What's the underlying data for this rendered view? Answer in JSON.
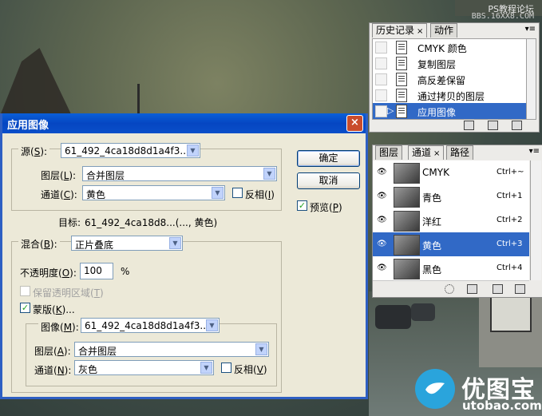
{
  "watermark": {
    "site_cn": "PS教程论坛",
    "site_url": "BBS.16XX8.COM",
    "brand_name": "优图宝",
    "brand_url": "utobao.com"
  },
  "history_panel": {
    "tabs": [
      {
        "label": "历史记录",
        "close": "×"
      },
      {
        "label": "动作"
      }
    ],
    "items": [
      "CMYK 颜色",
      "复制图层",
      "高反差保留",
      "通过拷贝的图层",
      "应用图像"
    ],
    "selected_index": 4,
    "menu_icon": "panel-menu-icon",
    "accent": "#3169c6"
  },
  "channels_panel": {
    "tabs": [
      {
        "label": "图层"
      },
      {
        "label": "通道",
        "close": "×"
      },
      {
        "label": "路径"
      }
    ],
    "channels": [
      {
        "name": "CMYK",
        "shortcut": "Ctrl+~"
      },
      {
        "name": "青色",
        "shortcut": "Ctrl+1"
      },
      {
        "name": "洋红",
        "shortcut": "Ctrl+2"
      },
      {
        "name": "黄色",
        "shortcut": "Ctrl+3"
      },
      {
        "name": "黑色",
        "shortcut": "Ctrl+4"
      }
    ],
    "selected_index": 3
  },
  "dialog": {
    "title": "应用图像",
    "source_label": "源(",
    "source_key": "S",
    "source_value": "61_492_4ca18d8d1a4f3...",
    "layer_label": "图层(",
    "layer_key": "L",
    "layer_value": "合并图层",
    "channel_label": "通道(",
    "channel_key": "C",
    "channel_value": "黄色",
    "invert_label": "反相(",
    "invert_key": "I",
    "invert_checked": false,
    "target_label": "目标:",
    "target_value": "61_492_4ca18d8...(..., 黄色)",
    "blend_label": "混合(",
    "blend_key": "B",
    "blend_value": "正片叠底",
    "opacity_label": "不透明度(",
    "opacity_key": "O",
    "opacity_value": "100",
    "opacity_unit": "%",
    "preserve_label": "保留透明区域(",
    "preserve_key": "T",
    "mask_label": "蒙版(",
    "mask_key": "K",
    "mask_suffix": ")...",
    "mask_checked": true,
    "mask_image_label": "图像(",
    "mask_image_key": "M",
    "mask_image_value": "61_492_4ca18d8d1a4f3...",
    "mask_layer_label": "图层(",
    "mask_layer_key": "A",
    "mask_layer_value": "合并图层",
    "mask_channel_label": "通道(",
    "mask_channel_key": "N",
    "mask_channel_value": "灰色",
    "mask_invert_label": "反相(",
    "mask_invert_key": "V",
    "mask_invert_checked": false,
    "ok_label": "确定",
    "cancel_label": "取消",
    "preview_label": "预览(",
    "preview_key": "P",
    "preview_checked": true,
    "close_glyph": "×",
    "title_color": "#0a5fd8"
  }
}
